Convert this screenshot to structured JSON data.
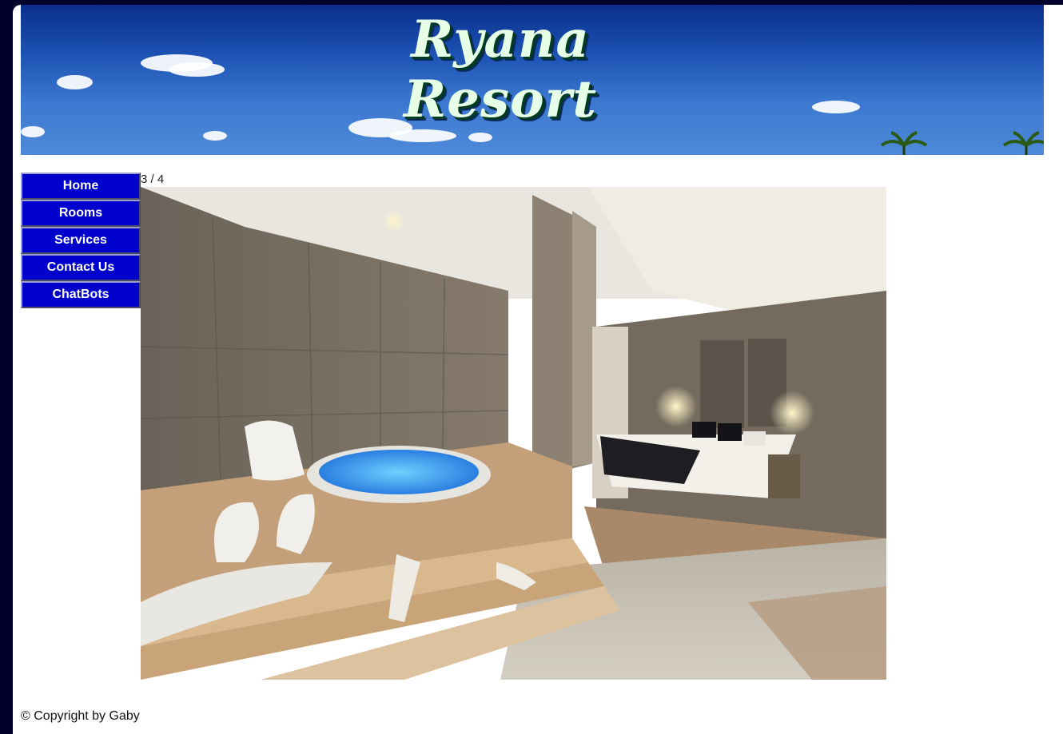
{
  "banner": {
    "title": "Ryana Resort"
  },
  "nav": {
    "items": [
      {
        "label": "Home"
      },
      {
        "label": "Rooms"
      },
      {
        "label": "Services"
      },
      {
        "label": "Contact Us"
      },
      {
        "label": "ChatBots"
      }
    ]
  },
  "slideshow": {
    "counter": "3 / 4"
  },
  "footer": {
    "text": "© Copyright by Gaby"
  },
  "colors": {
    "nav_bg": "#0000cc",
    "page_border": "#00002a",
    "sky": "#1a4fb0"
  }
}
